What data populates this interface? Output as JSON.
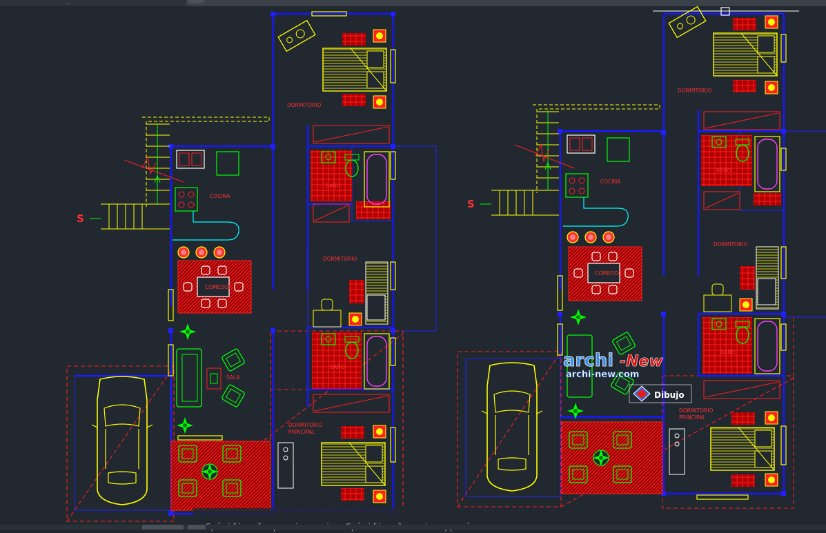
{
  "app": {
    "title": "_"
  },
  "plan_left": {
    "rooms": {
      "dormitorio_top": "DORMITORIO",
      "bano_top": "BAÑO",
      "dormitorio_mid": "DORMITORIO",
      "cocina": "COCINA",
      "comedor": "COMEDOR",
      "sala": "SALA",
      "bano_bottom": "BAÑO",
      "dormitorio_principal_1": "DORMITORIO",
      "dormitorio_principal_2": "PRINCIPAL"
    },
    "stair_label": "S"
  },
  "plan_right": {
    "rooms": {
      "dormitorio_top": "DORMITORIO",
      "cocina": "COCINA",
      "bano_top": "BAÑO",
      "comedor": "COMEDOR",
      "dormitorio_mid": "DORMITORIO",
      "bano_bottom": "BAÑO",
      "dormitorio_principal_1": "DORMITORIO",
      "dormitorio_principal_2": "PRINCIPAL"
    },
    "stair_label": "S"
  },
  "watermark": {
    "brand_a": "archi",
    "brand_b": "-New",
    "url": "archi-new.com",
    "logo_text": "Dibujo"
  },
  "command_line": {
    "prompt": "Spécifiez le premier coin: Spécifiez le coin opposé:"
  },
  "colors": {
    "background": "#212830",
    "wall": "#1010ff",
    "furniture": "#ffff00",
    "text": "#ff3030",
    "plants": "#00ff00",
    "counter": "#00ffff",
    "fixture": "#ff00ff"
  }
}
